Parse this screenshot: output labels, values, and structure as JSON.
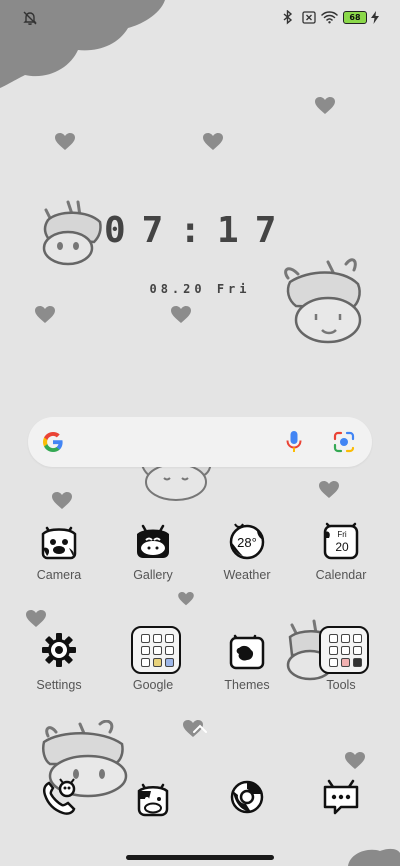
{
  "status_bar": {
    "left_icon": "alarm-off-icon",
    "right_icons": [
      "bluetooth-icon",
      "no-sim-icon",
      "wifi-icon",
      "battery-icon",
      "charging-bolt-icon"
    ],
    "battery_level": "68"
  },
  "clock": {
    "time": "07:17",
    "date": "08.20 Fri"
  },
  "search_bar": {
    "icons": [
      "google-logo-icon",
      "microphone-icon",
      "lens-camera-icon"
    ],
    "colors": {
      "blue": "#4285F4",
      "red": "#EA4335",
      "yellow": "#FBBC05",
      "green": "#34A853"
    }
  },
  "apps": [
    {
      "label": "Camera",
      "icon": "cow-camera-icon"
    },
    {
      "label": "Gallery",
      "icon": "cow-gallery-icon"
    },
    {
      "label": "Weather",
      "icon": "weather-icon",
      "value": "28°"
    },
    {
      "label": "Calendar",
      "icon": "calendar-icon",
      "day": "Fri",
      "date": "20"
    },
    {
      "label": "Settings",
      "icon": "gear-icon"
    },
    {
      "label": "Google",
      "icon": "folder-icon"
    },
    {
      "label": "Themes",
      "icon": "themes-icon"
    },
    {
      "label": "Tools",
      "icon": "folder-icon"
    }
  ],
  "dock": [
    "phone-icon",
    "cow-face-icon",
    "browser-icon",
    "messages-icon"
  ]
}
